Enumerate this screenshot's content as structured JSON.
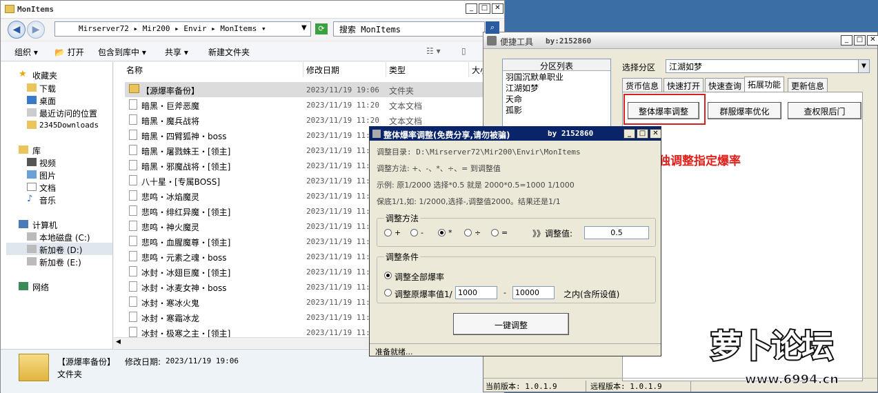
{
  "explorer": {
    "title": "MonItems",
    "breadcrumb": [
      "Mirserver72",
      "Mir200",
      "Envir",
      "MonItems"
    ],
    "search_placeholder": "搜索 MonItems",
    "toolbar": {
      "organize": "组织",
      "open": "打开",
      "include_library": "包含到库中",
      "share": "共享",
      "new_folder": "新建文件夹"
    },
    "sidebar": {
      "favorites": "收藏夹",
      "fav_items": [
        "下载",
        "桌面",
        "最近访问的位置",
        "2345Downloads"
      ],
      "libraries": "库",
      "lib_items": [
        "视频",
        "图片",
        "文档",
        "音乐"
      ],
      "computer": "计算机",
      "drives": [
        "本地磁盘 (C:)",
        "新加卷 (D:)",
        "新加卷 (E:)"
      ],
      "network": "网络"
    },
    "columns": {
      "name": "名称",
      "date": "修改日期",
      "type": "类型",
      "size": "大小"
    },
    "files": [
      {
        "name": "【源爆率备份】",
        "date": "2023/11/19 19:06",
        "type": "文件夹"
      },
      {
        "name": "暗黑・巨斧恶魔",
        "date": "2023/11/19 11:20",
        "type": "文本文档"
      },
      {
        "name": "暗黑・魔兵战将",
        "date": "2023/11/19 11:20",
        "type": "文本文档"
      },
      {
        "name": "暗黑・四臂狐神・boss",
        "date": "2023/11/19 11:2",
        "type": ""
      },
      {
        "name": "暗黑・屠戮蛛王・[领主]",
        "date": "2023/11/19 11:2",
        "type": ""
      },
      {
        "name": "暗黑・邪魔战将・[领主]",
        "date": "2023/11/19 11:2",
        "type": ""
      },
      {
        "name": "八十星・[专属BOSS]",
        "date": "2023/11/19 11:1",
        "type": ""
      },
      {
        "name": "悲鸣・冰焰魔灵",
        "date": "2023/11/19 11:2",
        "type": ""
      },
      {
        "name": "悲鸣・绯红异魔・[领主]",
        "date": "2023/11/19 11:2",
        "type": ""
      },
      {
        "name": "悲鸣・神火魔灵",
        "date": "2023/11/19 11:2",
        "type": ""
      },
      {
        "name": "悲鸣・血腥魔尊・[领主]",
        "date": "2023/11/19 11:2",
        "type": ""
      },
      {
        "name": "悲鸣・元素之魂・boss",
        "date": "2023/11/19 11:2",
        "type": ""
      },
      {
        "name": "冰封・冰翅巨魔・[领主]",
        "date": "2023/11/19 11:1",
        "type": ""
      },
      {
        "name": "冰封・冰麦女神・boss",
        "date": "2023/11/19 11:1",
        "type": ""
      },
      {
        "name": "冰封・寒冰火鬼",
        "date": "2023/11/19 11:1",
        "type": ""
      },
      {
        "name": "冰封・寒霜冰龙",
        "date": "2023/11/19 11:1",
        "type": ""
      },
      {
        "name": "冰封・极寒之主・[领主]",
        "date": "2023/11/19 11:1",
        "type": ""
      }
    ],
    "details": {
      "name": "【源爆率备份】",
      "modified_label": "修改日期:",
      "modified": "2023/11/19 19:06",
      "type": "文件夹"
    }
  },
  "tool": {
    "title": "便捷工具",
    "author": "by:2152860",
    "partition_list_header": "分区列表",
    "partitions": [
      "羽国沉默单职业",
      "江湖如梦",
      "天命",
      "孤影"
    ],
    "select_label": "选择分区",
    "selected_partition": "江湖如梦",
    "tabs": [
      "货币信息",
      "快速打开",
      "快速查询",
      "拓展功能",
      "更新信息"
    ],
    "buttons": [
      "整体爆率调整",
      "群服爆率优化",
      "查权限后门"
    ],
    "annotation": "也可单独调整指定爆率",
    "status_current": "当前版本: 1.0.1.9",
    "status_remote": "远程版本: 1.0.1.9"
  },
  "dialog": {
    "title": "整体爆率调整(免费分享,请勿被骗)",
    "author": "by 2152860",
    "dir_line": "调整目录: D:\\Mirserver72\\Mir200\\Envir\\MonItems",
    "method_line": "调整方法: +、-、*、÷、=  到调整值",
    "example_line": "示例: 原1/2000 选择*0.5 就是 2000*0.5=1000  1/1000",
    "min_line": "保底1/1,如: 1/2000,选择-,调整值2000。结果还是1/1",
    "method_group": "调整方法",
    "ops": [
      "+",
      "-",
      "*",
      "÷",
      "="
    ],
    "value_label": "》》调整值:",
    "value": "0.5",
    "cond_group": "调整条件",
    "cond_all": "调整全部爆率",
    "cond_range": "调整原爆率值1/",
    "range_from": "1000",
    "range_dash": "-",
    "range_to": "10000",
    "range_suffix": "之内(含所设值)",
    "apply_button": "一键调整",
    "status": "准备就绪..."
  },
  "watermark": {
    "text": "萝卜论坛",
    "url": "www.6994.cn"
  },
  "colors": {
    "title_blue": "#0a246a",
    "annotation_red": "#e0201a",
    "highlight_box": "#d62020"
  }
}
